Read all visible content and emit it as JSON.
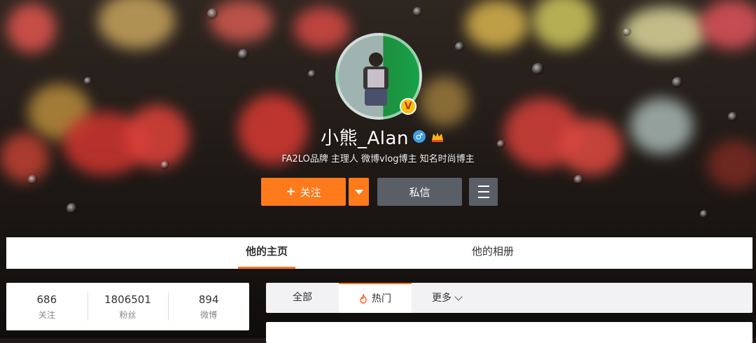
{
  "profile": {
    "name": "小熊_Alan",
    "verified_badge": "V",
    "gender_symbol": "♂",
    "bio": "FA2LO品牌 主理人 微博vlog博主 知名时尚博主"
  },
  "actions": {
    "follow_label": "关注",
    "follow_icon": "+",
    "message_label": "私信"
  },
  "tabs": {
    "home": "他的主页",
    "album": "他的相册"
  },
  "stats": [
    {
      "value": "686",
      "label": "关注"
    },
    {
      "value": "1806501",
      "label": "粉丝"
    },
    {
      "value": "894",
      "label": "微博"
    }
  ],
  "feed_filter": {
    "all": "全部",
    "hot": "热门",
    "more": "更多"
  },
  "colors": {
    "accent": "#ff7a1a",
    "secondary_button": "#5a5e66"
  }
}
